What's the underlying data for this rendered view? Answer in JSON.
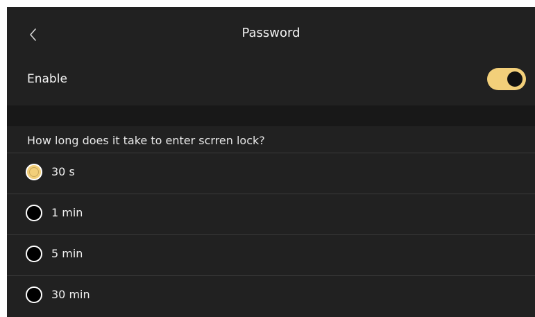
{
  "header": {
    "title": "Password",
    "back_icon": "chevron-left-icon"
  },
  "enable": {
    "label": "Enable",
    "toggle_on": true
  },
  "colors": {
    "background": "#212121",
    "accent": "#f2cf7a",
    "separator": "#181818"
  },
  "lock_section": {
    "question": "How long does it take to enter scrren lock?",
    "selected_index": 0,
    "options": [
      {
        "label": "30 s"
      },
      {
        "label": "1 min"
      },
      {
        "label": "5 min"
      },
      {
        "label": "30 min"
      }
    ]
  }
}
